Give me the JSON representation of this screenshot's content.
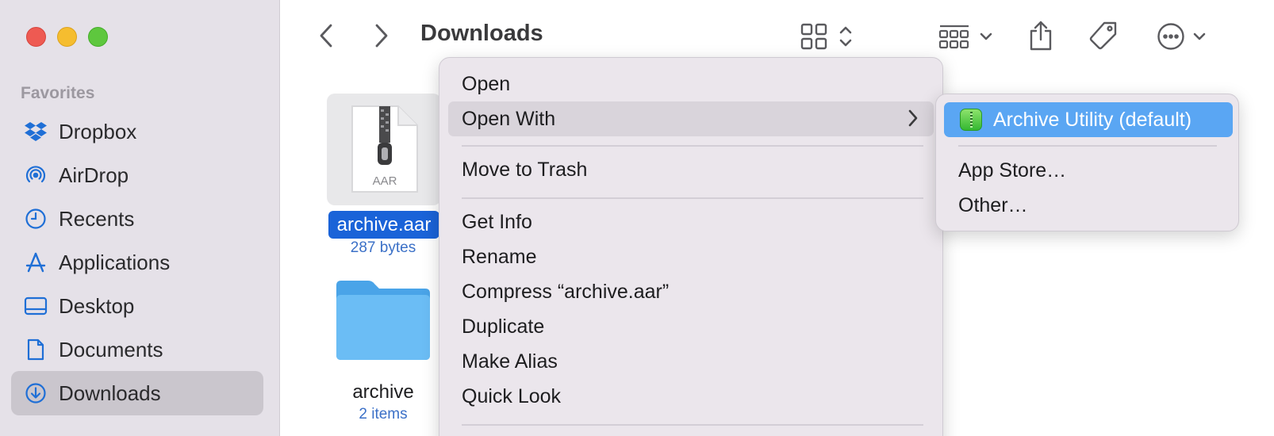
{
  "window": {
    "title": "Downloads"
  },
  "sidebar": {
    "section_title": "Favorites",
    "items": [
      {
        "label": "Dropbox",
        "icon": "dropbox-icon"
      },
      {
        "label": "AirDrop",
        "icon": "airdrop-icon"
      },
      {
        "label": "Recents",
        "icon": "clock-icon"
      },
      {
        "label": "Applications",
        "icon": "applications-icon"
      },
      {
        "label": "Desktop",
        "icon": "desktop-icon"
      },
      {
        "label": "Documents",
        "icon": "document-icon"
      },
      {
        "label": "Downloads",
        "icon": "download-icon",
        "selected": true
      }
    ]
  },
  "files": [
    {
      "name": "archive.aar",
      "subtitle": "287 bytes",
      "badge": "AAR",
      "selected": true
    },
    {
      "name": "archive",
      "subtitle": "2 items"
    }
  ],
  "context_menu": {
    "items": [
      "Open",
      "Open With",
      "Move to Trash",
      "Get Info",
      "Rename",
      "Compress “archive.aar”",
      "Duplicate",
      "Make Alias",
      "Quick Look"
    ],
    "highlighted": "Open With"
  },
  "submenu": {
    "default_app": "Archive Utility (default)",
    "items": [
      "App Store…",
      "Other…"
    ]
  },
  "colors": {
    "selection_blue": "#1a63d8",
    "submenu_highlight": "#5aa6f3",
    "accent_icon": "#1f6fd6"
  }
}
